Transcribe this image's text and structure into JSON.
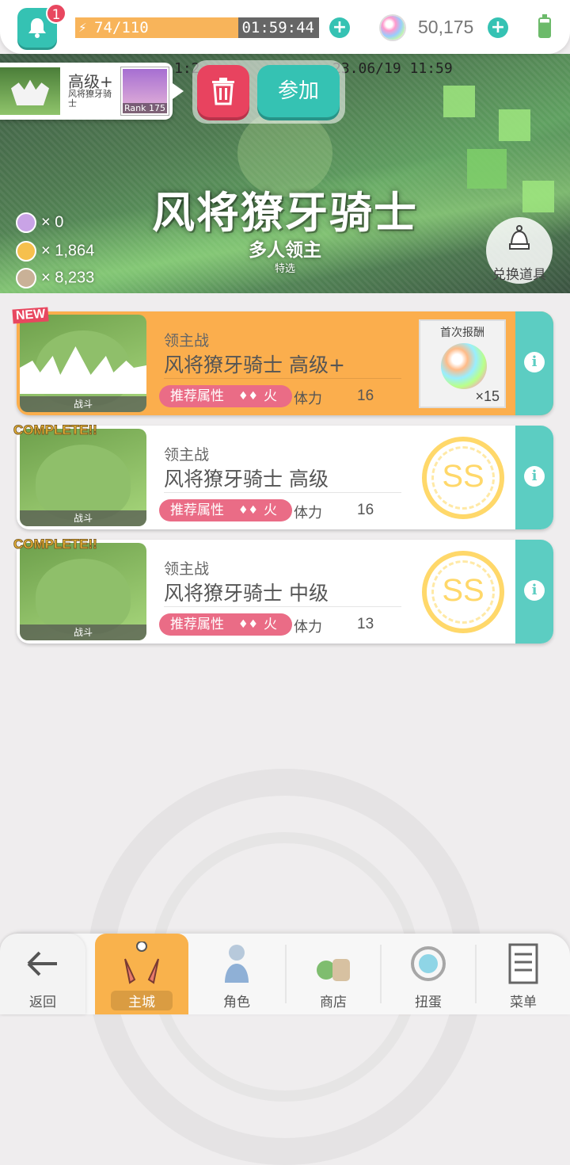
{
  "header": {
    "notifications": "1",
    "stamina": {
      "value": "74/110",
      "fraction": 0.67
    },
    "timer": "01:59:44",
    "gems": "50,175"
  },
  "banner": {
    "date_left": "1:2",
    "date_right": "23.06/19 11:59",
    "title": "风将獠牙骑士",
    "subtitle": "多人领主",
    "tag": "特选",
    "currencies": [
      {
        "amount": "× 0",
        "color": "#c9a3e6"
      },
      {
        "amount": "× 1,864",
        "color": "#f6c04d"
      },
      {
        "amount": "× 8,233",
        "color": "#c9b197"
      }
    ],
    "exchange_label": "兑换道具"
  },
  "popup": {
    "level": "高级+",
    "name": "风将獠牙骑士",
    "rank": "Rank 175"
  },
  "actions": {
    "join_label": "参加"
  },
  "quests": [
    {
      "tag": "NEW",
      "category": "领主战",
      "name": "风将獠牙骑士 高级+",
      "attr_label": "推荐属性",
      "element": "火",
      "stamina_label": "体力",
      "stamina": "16",
      "thumb_label": "战斗",
      "reward_header": "首次报酬",
      "reward_count": "×15"
    },
    {
      "tag": "COMPLETE!!",
      "category": "领主战",
      "name": "风将獠牙骑士 高级",
      "attr_label": "推荐属性",
      "element": "火",
      "stamina_label": "体力",
      "stamina": "16",
      "thumb_label": "战斗",
      "rank": "SS"
    },
    {
      "tag": "COMPLETE!!",
      "category": "领主战",
      "name": "风将獠牙骑士 中级",
      "attr_label": "推荐属性",
      "element": "火",
      "stamina_label": "体力",
      "stamina": "13",
      "thumb_label": "战斗",
      "rank": "SS"
    }
  ],
  "nav": {
    "back": "返回",
    "home": "主城",
    "characters": "角色",
    "shop": "商店",
    "gacha": "扭蛋",
    "menu": "菜单"
  },
  "colors": {
    "accent": "#35c2b3",
    "danger": "#e8435f",
    "highlight": "#fbae4d",
    "attr": "#ea6c86",
    "rank_gold": "#ffd86a"
  }
}
